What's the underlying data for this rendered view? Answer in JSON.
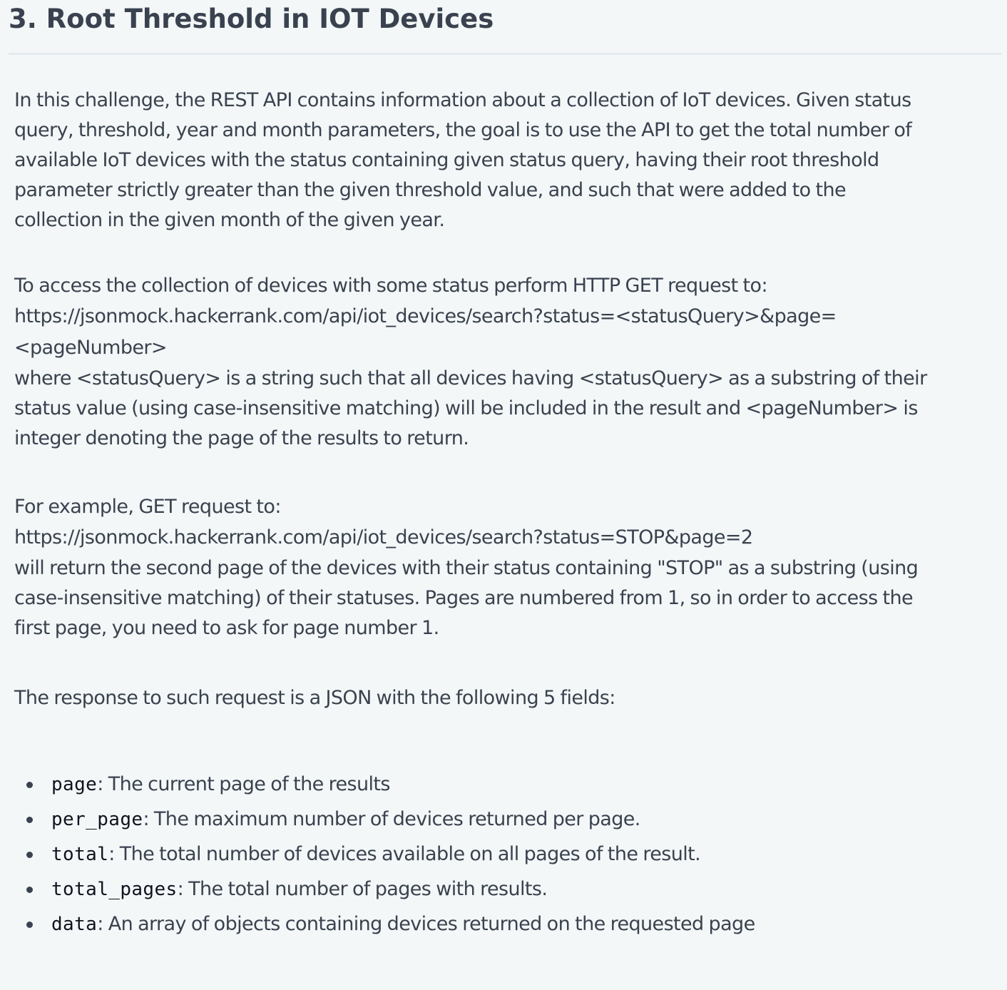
{
  "doc": {
    "title": "3. Root Threshold in IOT Devices",
    "paragraph1": [
      "In this challenge, the REST API contains information about a collection of IoT devices. Given status",
      "query, threshold, year and month parameters, the goal is to use the API to get the total number of",
      "available IoT devices with the status containing given status query, having their root threshold",
      "parameter strictly greater than the given threshold value, and such that were added to the",
      "collection in the given month of the given year."
    ],
    "paragraph2": {
      "intro": "To access the collection of devices with some status perform HTTP GET request to:",
      "url_line1": "https://jsonmock.hackerrank.com/api/iot_devices/search?status=<statusQuery>&page=",
      "url_line2": "<pageNumber>",
      "explanation": [
        "where <statusQuery> is a string such that all devices having <statusQuery> as a substring of their",
        "status value (using case-insensitive matching) will be included in the result and <pageNumber> is",
        "integer denoting the page of the results to return."
      ]
    },
    "paragraph3": {
      "intro": "For example, GET request to:",
      "url": "https://jsonmock.hackerrank.com/api/iot_devices/search?status=STOP&page=2",
      "explanation": [
        "will return the second page of the devices with their status containing \"STOP\" as a substring (using",
        "case-insensitive matching) of their statuses. Pages are numbered from 1, so in order to access the",
        "first page, you need to ask for page number 1."
      ]
    },
    "paragraph4": "The response to such request is a JSON with the following 5 fields:",
    "fields": [
      {
        "name": "page",
        "desc": ": The current page of the results"
      },
      {
        "name": "per_page",
        "desc": ": The maximum number of devices returned per page."
      },
      {
        "name": "total",
        "desc": ": The total number of devices available on all pages of the result."
      },
      {
        "name": "total_pages",
        "desc": ": The total number of pages with results."
      },
      {
        "name": "data",
        "desc": ": An array of objects containing devices returned on the requested page"
      }
    ]
  }
}
